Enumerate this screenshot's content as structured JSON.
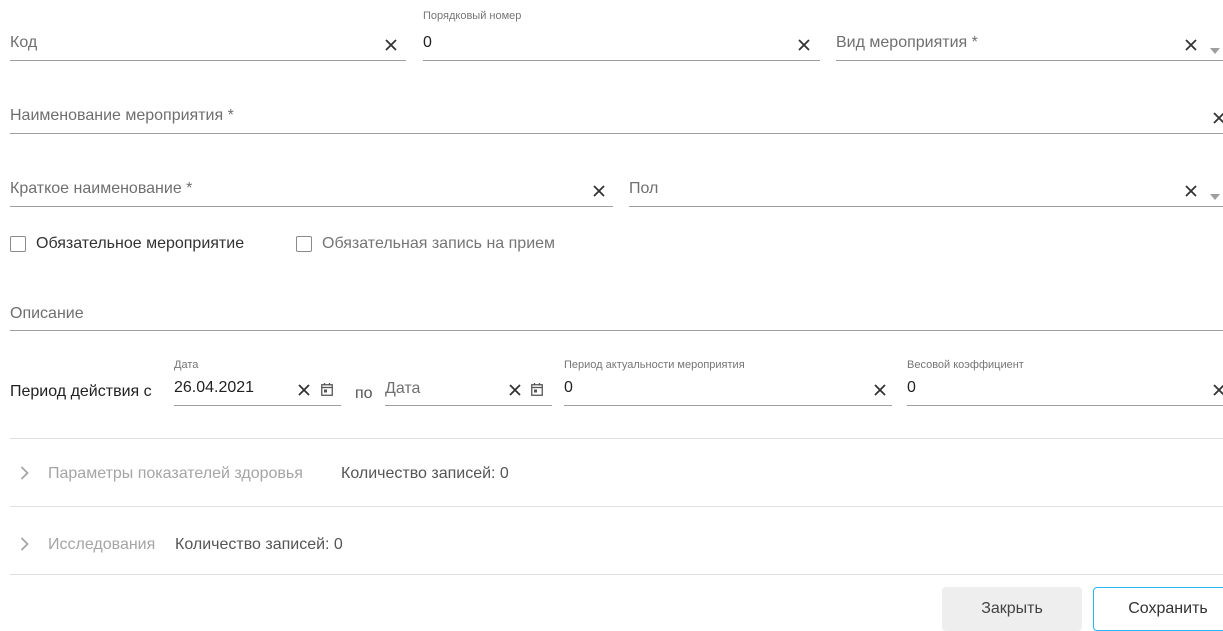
{
  "form": {
    "code": {
      "placeholder": "Код",
      "value": ""
    },
    "order_number": {
      "label": "Порядковый номер",
      "value": "0"
    },
    "event_type": {
      "placeholder": "Вид мероприятия *",
      "value": ""
    },
    "event_name": {
      "placeholder": "Наименование мероприятия *",
      "value": ""
    },
    "short_name": {
      "placeholder": "Краткое наименование *",
      "value": ""
    },
    "gender": {
      "placeholder": "Пол",
      "value": ""
    },
    "mandatory_event": {
      "label": "Обязательное мероприятие",
      "checked": false
    },
    "mandatory_appointment": {
      "label": "Обязательная запись на прием",
      "checked": false
    },
    "description": {
      "placeholder": "Описание",
      "value": ""
    },
    "period": {
      "prefix": "Период действия с",
      "from_label": "Дата",
      "from_value": "26.04.2021",
      "to_word": "по",
      "to_placeholder": "Дата"
    },
    "relevance_period": {
      "label": "Период актуальности мероприятия",
      "value": "0"
    },
    "weight_coefficient": {
      "label": "Весовой коэффициент",
      "value": "0"
    }
  },
  "sections": [
    {
      "title": "Параметры показателей здоровья",
      "count_text": "Количество записей: 0"
    },
    {
      "title": "Исследования",
      "count_text": "Количество записей: 0"
    }
  ],
  "buttons": {
    "close": "Закрыть",
    "save": "Сохранить"
  },
  "icons": {
    "clear": "close-icon",
    "dropdown": "caret-down-icon",
    "calendar": "calendar-icon",
    "expand": "chevron-right-icon"
  },
  "colors": {
    "save_border": "#29b6f6",
    "close_bg": "#eeeeee",
    "section_title": "#a5a5a5"
  }
}
